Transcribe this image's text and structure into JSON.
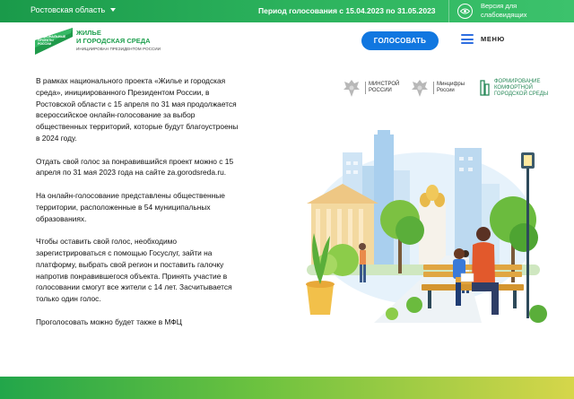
{
  "topbar": {
    "region": "Ростовская область",
    "period": "Период голосования с 15.04.2023 по 31.05.2023",
    "accessibility_line1": "Версия для",
    "accessibility_line2": "слабовидящих"
  },
  "header": {
    "logo_flag_text": [
      "НАЦИОНАЛЬНЫЕ",
      "ПРОЕКТЫ",
      "РОССИИ"
    ],
    "logo_title_line1": "ЖИЛЬЕ",
    "logo_title_line2": "И ГОРОДСКАЯ СРЕДА",
    "logo_subtitle": "ИНИЦИИРОВАН ПРЕЗИДЕНТОМ РОССИИ",
    "vote_button": "ГОЛОСОВАТЬ",
    "menu_label": "МЕНЮ"
  },
  "partners": [
    {
      "name": [
        "МИНСТРОЙ",
        "РОССИИ"
      ],
      "icon": "eagle-emblem-icon"
    },
    {
      "name": [
        "Минцифры",
        "России"
      ],
      "icon": "eagle-emblem-icon"
    },
    {
      "name": [
        "ФОРМИРОВАНИЕ",
        "КОМФОРТНОЙ",
        "ГОРОДСКОЙ СРЕДЫ"
      ],
      "icon": "comfort-city-logo-icon"
    }
  ],
  "content": {
    "paragraphs": [
      "В рамках национального проекта «Жилье и городская среда», инициированного Президентом России, в Ростовской области с 15 апреля по 31 мая продолжается всероссийское онлайн-голосование за выбор общественных территорий, которые будут благоустроены в 2024 году.",
      "Отдать свой голос за понравившийся проект можно с 15 апреля по 31 мая 2023 года на сайте za.gorodsreda.ru.",
      "На онлайн-голосование представлены общественные территории, расположенные в 54 муниципальных образованиях.",
      "Чтобы оставить свой голос, необходимо зарегистрироваться с помощью Госуслуг, зайти на платформу, выбрать свой регион и поставить галочку напротив понравившегося объекта. Принять участие в голосовании смогут все жители с 14 лет. Засчитывается только один голос.",
      "Проголосовать можно будет также в МФЦ"
    ]
  },
  "colors": {
    "topbar_green": "#2db45e",
    "brand_green": "#20a04f",
    "button_blue": "#1177e0",
    "menu_blue": "#2f6fe0"
  }
}
